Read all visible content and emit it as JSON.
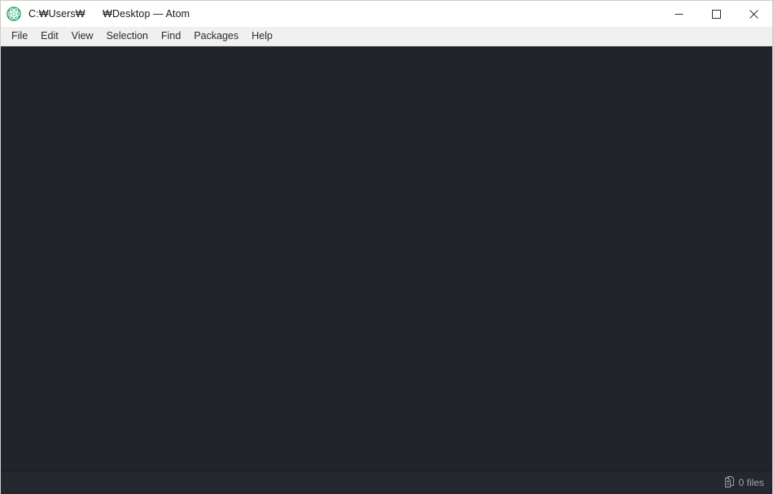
{
  "window": {
    "app_name": "Atom",
    "app_icon": "atom-logo-icon",
    "title": "C:₩Users₩      ₩Desktop — Atom",
    "controls": {
      "minimize": "minimize-icon",
      "maximize": "maximize-icon",
      "close": "close-icon"
    }
  },
  "menubar": {
    "items": [
      {
        "label": "File"
      },
      {
        "label": "Edit"
      },
      {
        "label": "View"
      },
      {
        "label": "Selection"
      },
      {
        "label": "Find"
      },
      {
        "label": "Packages"
      },
      {
        "label": "Help"
      }
    ]
  },
  "editor": {
    "content": "",
    "background_color": "#21242b"
  },
  "statusbar": {
    "background_color": "#24272e",
    "text_color": "#9da5b4",
    "left_items": [],
    "right_items": [
      {
        "icon": "git-diff-files-icon",
        "label": "0 files"
      }
    ]
  },
  "colors": {
    "titlebar_background": "#ffffff",
    "menubar_background": "#f0f0f0",
    "window_border": "#cfcbc7",
    "accent_green": "#4bb570"
  }
}
